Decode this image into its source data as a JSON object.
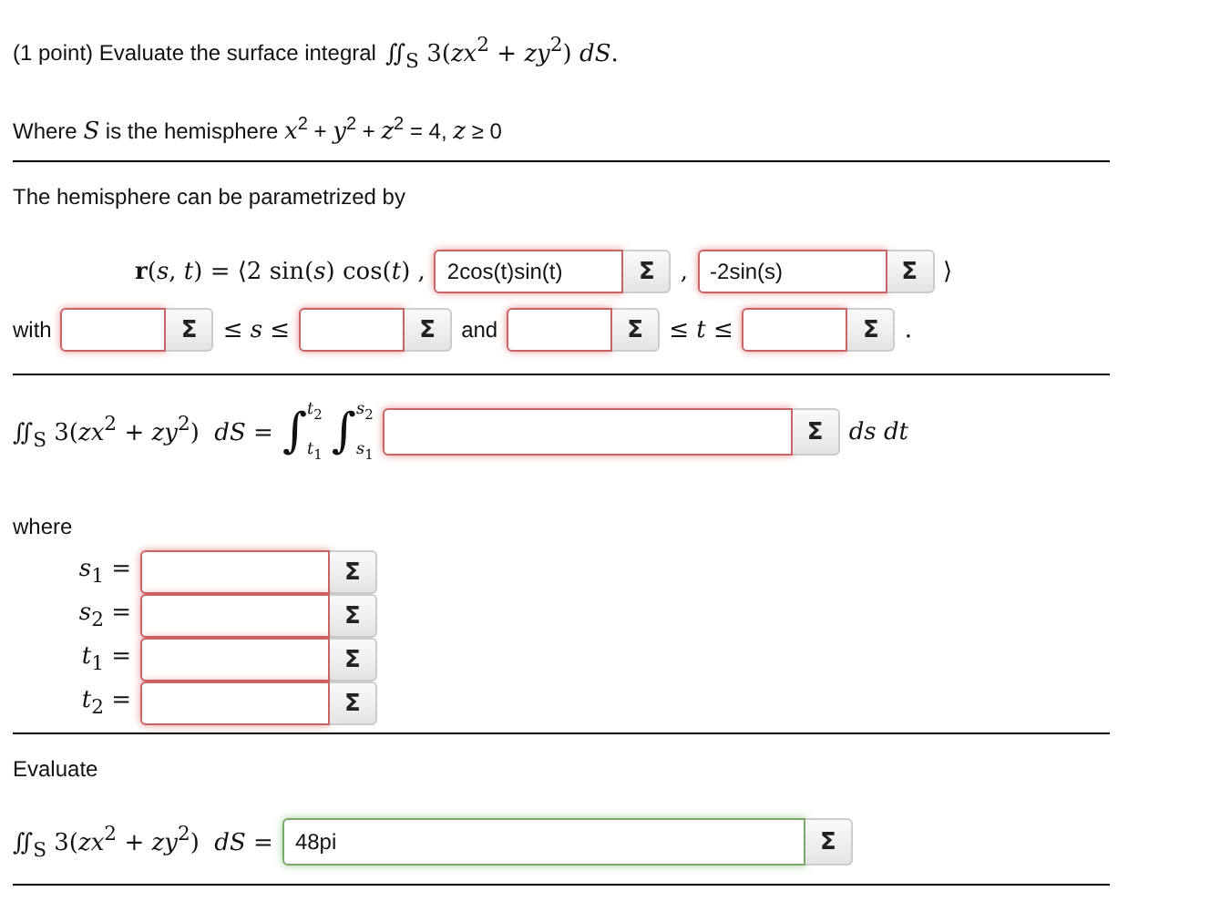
{
  "sections": [
    {
      "rows": [
        {
          "kind": "statement",
          "items": [
            {
              "kind": "text",
              "text": "(1 point) Evaluate the surface integral"
            },
            {
              "kind": "math",
              "text": "∬$_{S}$ 3(*zx*$^{2}$ + *zy*$^{2}$) *dS*."
            }
          ]
        },
        {
          "kind": "statement",
          "items": [
            {
              "kind": "text",
              "text": "Where *S* is the hemisphere *x*$^{2}$ + *y*$^{2}$ + *z*$^{2}$ = 4,  *z* ≥ 0"
            }
          ]
        }
      ]
    },
    {
      "rows": [
        {
          "kind": "statement",
          "items": [
            {
              "kind": "text",
              "text": "The hemisphere can be parametrized by"
            }
          ]
        },
        {
          "kind": "vector",
          "items": [
            {
              "kind": "math",
              "text": "**r**(*s*, *t*) = ⟨2 sin(*s*) cos(*t*) ,"
            },
            {
              "kind": "field",
              "value": "2cos(t)sin(t)",
              "button": "Σ",
              "correct": false
            },
            {
              "kind": "math",
              "text": ","
            },
            {
              "kind": "field",
              "value": "-2sin(s)",
              "button": "Σ",
              "correct": false
            },
            {
              "kind": "math",
              "text": "⟩"
            }
          ]
        },
        {
          "kind": "bounds",
          "items": [
            {
              "kind": "text",
              "text": "with"
            },
            {
              "kind": "field",
              "value": "",
              "button": "Σ",
              "correct": false
            },
            {
              "kind": "math",
              "text": "≤ *s* ≤"
            },
            {
              "kind": "field",
              "value": "",
              "button": "Σ",
              "correct": false
            },
            {
              "kind": "text",
              "text": "and"
            },
            {
              "kind": "field",
              "value": "",
              "button": "Σ",
              "correct": false
            },
            {
              "kind": "math",
              "text": "≤ *t* ≤"
            },
            {
              "kind": "field",
              "value": "",
              "button": "Σ",
              "correct": false
            },
            {
              "kind": "math",
              "text": "."
            }
          ]
        }
      ]
    },
    {
      "rows": [
        {
          "kind": "integrand",
          "items": [
            {
              "kind": "math",
              "text": "∬$_{S}$ 3(*zx*$^{2}$ + *zy*$^{2}$)  *dS* ="
            },
            {
              "kind": "integral",
              "sign": "∫",
              "lower": "*t*$_{1}$",
              "upper": "*t*$_{2}$"
            },
            {
              "kind": "integral",
              "sign": "∫",
              "lower": "*s*$_{1}$",
              "upper": "*s*$_{2}$"
            },
            {
              "kind": "field",
              "value": "",
              "button": "Σ",
              "correct": false
            },
            {
              "kind": "math",
              "text": "*ds dt*"
            }
          ]
        },
        {
          "kind": "statement",
          "items": [
            {
              "kind": "text",
              "text": "where"
            }
          ]
        },
        {
          "kind": "definition",
          "items": [
            {
              "kind": "math",
              "text": "*s*$_{1}$ ="
            },
            {
              "kind": "field",
              "value": "",
              "button": "Σ",
              "correct": false
            }
          ]
        },
        {
          "kind": "definition",
          "items": [
            {
              "kind": "math",
              "text": "*s*$_{2}$ ="
            },
            {
              "kind": "field",
              "value": "",
              "button": "Σ",
              "correct": false
            }
          ]
        },
        {
          "kind": "definition",
          "items": [
            {
              "kind": "math",
              "text": "*t*$_{1}$ ="
            },
            {
              "kind": "field",
              "value": "",
              "button": "Σ",
              "correct": false
            }
          ]
        },
        {
          "kind": "definition",
          "items": [
            {
              "kind": "math",
              "text": "*t*$_{2}$ ="
            },
            {
              "kind": "field",
              "value": "",
              "button": "Σ",
              "correct": false
            }
          ]
        }
      ]
    },
    {
      "rows": [
        {
          "kind": "statement",
          "items": [
            {
              "kind": "text",
              "text": "Evaluate"
            }
          ]
        },
        {
          "kind": "result",
          "items": [
            {
              "kind": "math",
              "text": "∬$_{S}$ 3(*zx*$^{2}$ + *zy*$^{2}$)  *dS* ="
            },
            {
              "kind": "field",
              "value": "48pi",
              "button": "Σ",
              "correct": true
            }
          ]
        }
      ]
    }
  ]
}
